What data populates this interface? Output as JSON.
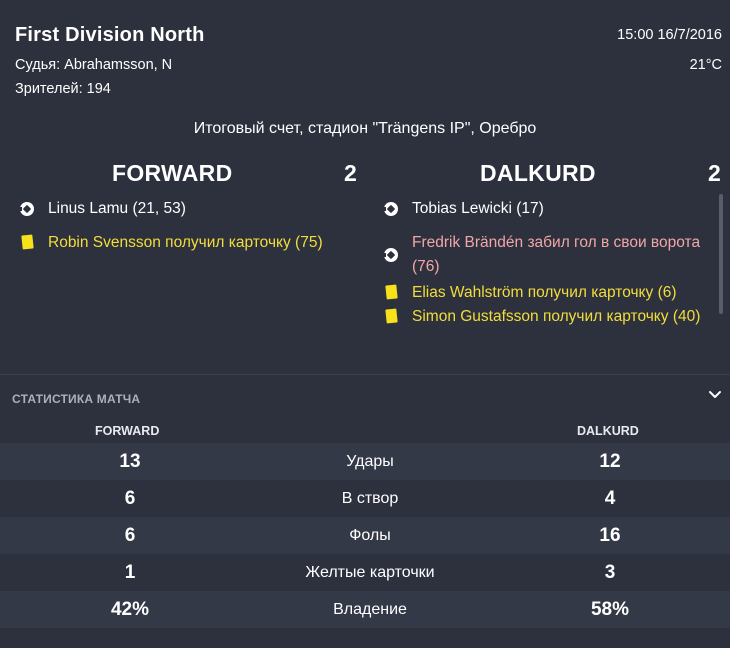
{
  "header": {
    "competition": "First Division North",
    "referee": "Судья: Abrahamsson, N",
    "attendance": "Зрителей: 194",
    "datetime": "15:00 16/7/2016",
    "temperature": "21°C",
    "venue": "Итоговый счет, стадион \"Trängens IP\", Оребро"
  },
  "home": {
    "name": "FORWARD",
    "score": "2",
    "events": [
      {
        "type": "goal",
        "text": "Linus Lamu (21, 53)"
      },
      {
        "type": "card",
        "text": "Robin Svensson получил карточку (75)"
      }
    ]
  },
  "away": {
    "name": "DALKURD",
    "score": "2",
    "events": [
      {
        "type": "goal",
        "text": "Tobias Lewicki (17)"
      },
      {
        "type": "owngoal",
        "text": "Fredrik Brändén забил гол в свои ворота (76)"
      },
      {
        "type": "card",
        "text": "Elias Wahlström получил карточку (6)"
      },
      {
        "type": "card",
        "text": "Simon Gustafsson получил карточку (40)"
      }
    ]
  },
  "stats": {
    "title": "СТАТИСТИКА МАТЧА",
    "home_label": "FORWARD",
    "away_label": "DALKURD",
    "rows": [
      {
        "label": "Удары",
        "home": "13",
        "away": "12"
      },
      {
        "label": "В створ",
        "home": "6",
        "away": "4"
      },
      {
        "label": "Фолы",
        "home": "6",
        "away": "16"
      },
      {
        "label": "Желтые карточки",
        "home": "1",
        "away": "3"
      },
      {
        "label": "Владение",
        "home": "42%",
        "away": "58%"
      }
    ]
  },
  "colors": {
    "background": "#2c313d",
    "card_text": "#f3dd3a",
    "own_goal_text": "#f2a6a6"
  },
  "icons": {
    "goal": "football-icon",
    "card": "yellow-card-icon",
    "collapse": "chevron-down-icon"
  }
}
